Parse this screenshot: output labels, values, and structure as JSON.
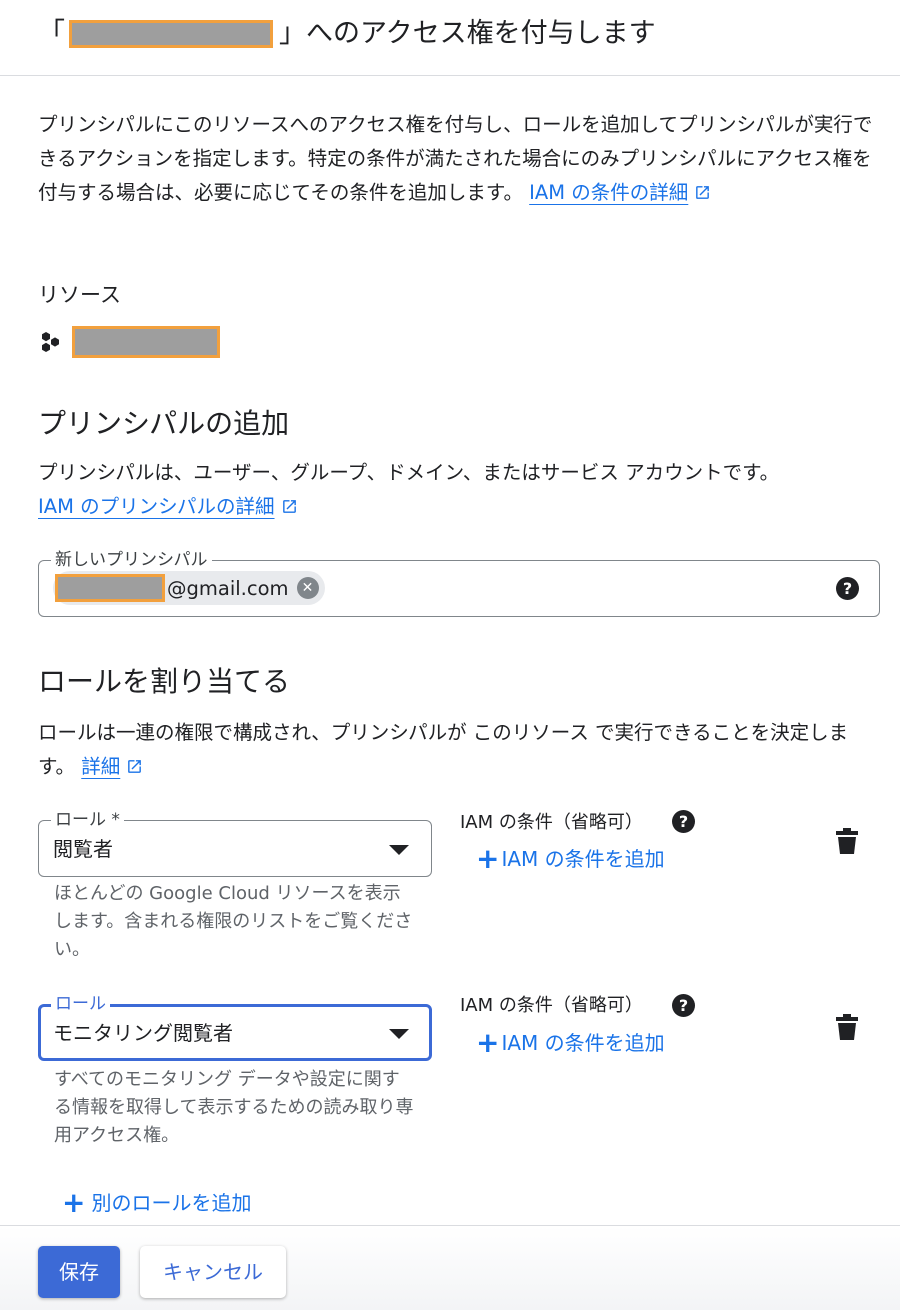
{
  "header": {
    "title_open": "「",
    "title_close": "」へのアクセス権を付与します"
  },
  "intro": {
    "text": "プリンシパルにこのリソースへのアクセス権を付与し、ロールを追加してプリンシパルが実行できるアクションを指定します。特定の条件が満たされた場合にのみプリンシパルにアクセス権を付与する場合は、必要に応じてその条件を追加します。",
    "link": "IAM の条件の詳細"
  },
  "resource": {
    "label": "リソース",
    "icon": "project-hexagons-icon"
  },
  "principals": {
    "heading": "プリンシパルの追加",
    "description": "プリンシパルは、ユーザー、グループ、ドメイン、またはサービス アカウントです。",
    "link": "IAM のプリンシパルの詳細",
    "field_label": "新しいプリンシパル",
    "chip_suffix": "@gmail.com",
    "chip_remove": "✕",
    "help": "?"
  },
  "roles": {
    "heading": "ロールを割り当てる",
    "description": "ロールは一連の権限で構成され、プリンシパルが このリソース で実行できることを決定します。",
    "link": "詳細",
    "items": [
      {
        "field_label": "ロール *",
        "value": "閲覧者",
        "hint": "ほとんどの Google Cloud リソースを表示します。含まれる権限のリストをご覧ください。",
        "condition_label": "IAM の条件（省略可）",
        "add_condition": "IAM の条件を追加"
      },
      {
        "field_label": "ロール",
        "value": "モニタリング閲覧者",
        "hint": "すべてのモニタリング データや設定に関する情報を取得して表示するための読み取り専用アクセス権。",
        "condition_label": "IAM の条件（省略可）",
        "add_condition": "IAM の条件を追加"
      }
    ],
    "add_role": "別のロールを追加",
    "plus": "+"
  },
  "footer": {
    "save": "保存",
    "cancel": "キャンセル"
  },
  "colors": {
    "accent": "#3c6ad6",
    "link": "#1a73e8",
    "redaction_fill": "#9e9e9e",
    "redaction_border": "#f2a03d"
  }
}
